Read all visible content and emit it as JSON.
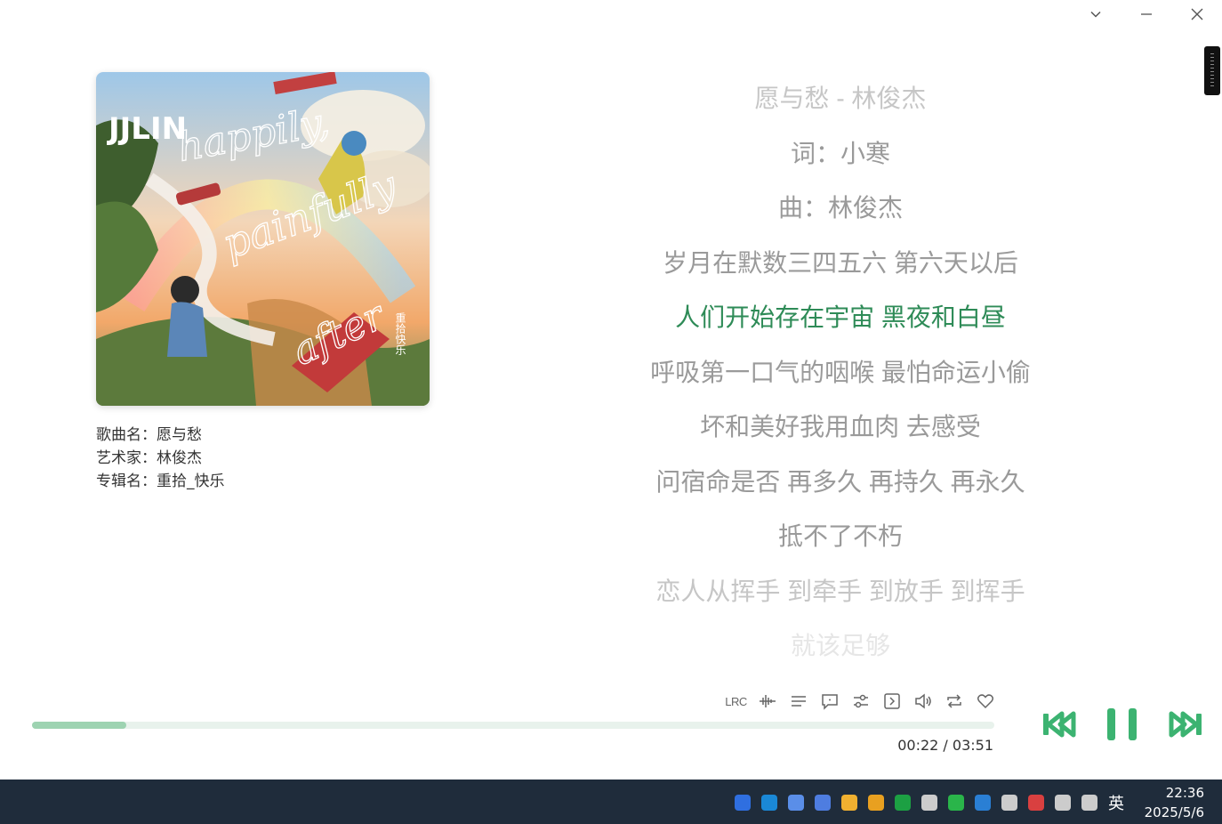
{
  "window": {
    "controls": [
      {
        "name": "collapse-button",
        "icon": "chevron-down-icon"
      },
      {
        "name": "minimize-button",
        "icon": "minimize-icon"
      },
      {
        "name": "close-button",
        "icon": "close-icon"
      }
    ]
  },
  "album_art": {
    "artist_logo": "JJLIN",
    "title_script": "happily, painfully after",
    "album_cn": "重拾快乐"
  },
  "song_info": {
    "song_label": "歌曲名：",
    "song": "愿与愁",
    "artist_label": "艺术家：",
    "artist": "林俊杰",
    "album_label": "专辑名：",
    "album": "重拾_快乐"
  },
  "lyrics": [
    {
      "text": "愿与愁 - 林俊杰",
      "state": "fade1"
    },
    {
      "text": "词：小寒",
      "state": "normal"
    },
    {
      "text": "曲：林俊杰",
      "state": "normal"
    },
    {
      "text": "岁月在默数三四五六 第六天以后",
      "state": "normal"
    },
    {
      "text": "人们开始存在宇宙 黑夜和白昼",
      "state": "active"
    },
    {
      "text": "呼吸第一口气的咽喉 最怕命运小偷",
      "state": "normal"
    },
    {
      "text": "坏和美好我用血肉 去感受",
      "state": "normal"
    },
    {
      "text": "问宿命是否 再多久 再持久 再永久",
      "state": "normal"
    },
    {
      "text": "抵不了不朽",
      "state": "normal"
    },
    {
      "text": "恋人从挥手 到牵手 到放手 到挥手",
      "state": "fade1"
    },
    {
      "text": "就该足够",
      "state": "fade2"
    }
  ],
  "toolbar": {
    "lrc_label": "LRC",
    "icons": [
      "lrc-icon",
      "waveform-icon",
      "playlist-icon",
      "comment-icon",
      "equalizer-icon",
      "next-panel-icon",
      "volume-icon",
      "repeat-icon",
      "like-icon"
    ]
  },
  "playback": {
    "current": "00:22",
    "separator": "/",
    "total": "03:51",
    "progress": 0.098,
    "accent": "#3cb371",
    "progress_fill": "#9dd3b1",
    "progress_track": "#e8f2ec"
  },
  "transport": [
    "previous-button",
    "pause-button",
    "next-button"
  ],
  "taskbar": {
    "tray_colors": [
      "#2f6fe0",
      "#1a88d6",
      "#5a8ee8",
      "#4e7de0",
      "#f0b030",
      "#e8a020",
      "#1ca043",
      "#cccccc",
      "#2ab54a",
      "#2a7fd4",
      "#cccccc",
      "#d94040",
      "#cccccc",
      "#cccccc"
    ],
    "ime": "英",
    "time": "22:36",
    "date": "2025/5/6"
  }
}
